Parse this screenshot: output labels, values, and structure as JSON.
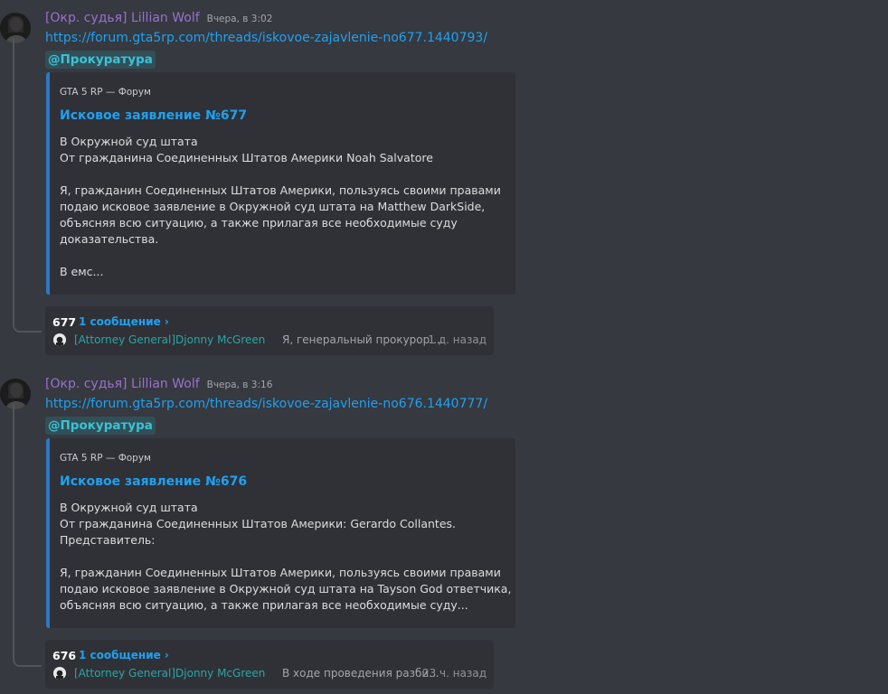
{
  "messages": [
    {
      "author": "[Окр. судья] Lillian Wolf",
      "time": "Вчера, в 3:02",
      "link": "https://forum.gta5rp.com/threads/iskovoe-zajavlenie-no677.1440793/",
      "mention": "@Прокуратура",
      "embed": {
        "provider": "GTA 5 RP — Форум",
        "title": "Исковое заявление №677",
        "lines": [
          "В Окружной суд штата",
          "От гражданина Соединенных Штатов Америки Noah Salvatore",
          "",
          "Я, гражданин Соединенных Штатов Америки, пользуясь своими правами",
          "подаю исковое заявление в Окружной суд штата на Matthew DarkSide,",
          "объясняя всю ситуацию, а также прилагая все необходимые суду",
          "доказательства.",
          "",
          "В емс..."
        ]
      },
      "thread": {
        "name": "677",
        "count": "1 сообщение ›",
        "author": "[Attorney General]Djonny McGreen",
        "preview": "Я, генеральный прокурор ...",
        "time": "1 д. назад"
      }
    },
    {
      "author": "[Окр. судья] Lillian Wolf",
      "time": "Вчера, в 3:16",
      "link": "https://forum.gta5rp.com/threads/iskovoe-zajavlenie-no676.1440777/",
      "mention": "@Прокуратура",
      "embed": {
        "provider": "GTA 5 RP — Форум",
        "title": "Исковое заявление №676",
        "lines": [
          "В Окружной суд штата",
          "От гражданина Соединенных Штатов Америки: Gerardo Collantes.",
          "Представитель:",
          "",
          "Я, гражданин Соединенных Штатов Америки, пользуясь своими правами",
          "подаю исковое заявление в Окружной суд штата на Tayson God ответчика,",
          "объясняя всю ситуацию, а также прилагая все необходимые суду..."
        ]
      },
      "thread": {
        "name": "676",
        "count": "1 сообщение ›",
        "author": "[Attorney General]Djonny McGreen",
        "preview": "В ходе проведения разби...",
        "time": "23 ч. назад"
      }
    }
  ],
  "colors": {
    "background": "#36393f",
    "embed_bg": "#2f3136",
    "embed_border": "#2b79c7",
    "author": "#9b6fd1",
    "link": "#1ea1f2",
    "mention": "#3ac3d8"
  },
  "icons": {
    "avatar": "user-avatar",
    "thread_avatar": "thread-user-avatar"
  }
}
